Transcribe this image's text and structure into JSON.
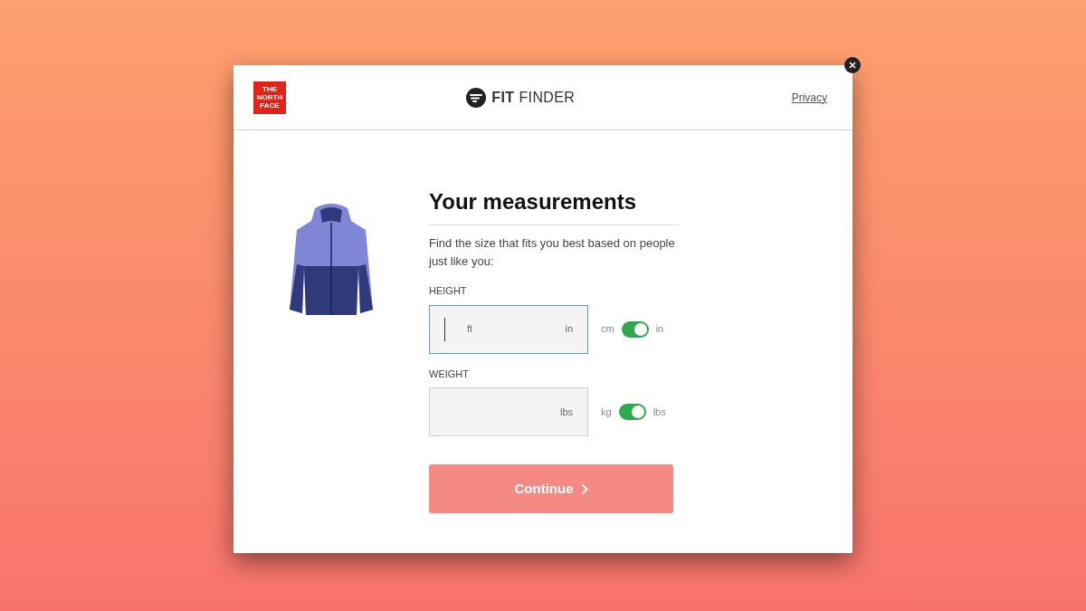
{
  "header": {
    "logo_text": "THE NORTH FACE",
    "brand_bold": "FIT",
    "brand_light": "FINDER",
    "privacy_link": "Privacy"
  },
  "form": {
    "title": "Your measurements",
    "intro": "Find the size that fits you best based on people just like you:",
    "fields": [
      {
        "label": "HEIGHT",
        "focused": true,
        "units": [
          "ft",
          "in"
        ],
        "toggle": {
          "off_label": "cm",
          "on_label": "in",
          "on": true
        }
      },
      {
        "label": "WEIGHT",
        "focused": false,
        "units": [
          "lbs"
        ],
        "toggle": {
          "off_label": "kg",
          "on_label": "lbs",
          "on": true
        }
      }
    ],
    "continue_button": {
      "label": "Continue",
      "disabled": true
    }
  }
}
